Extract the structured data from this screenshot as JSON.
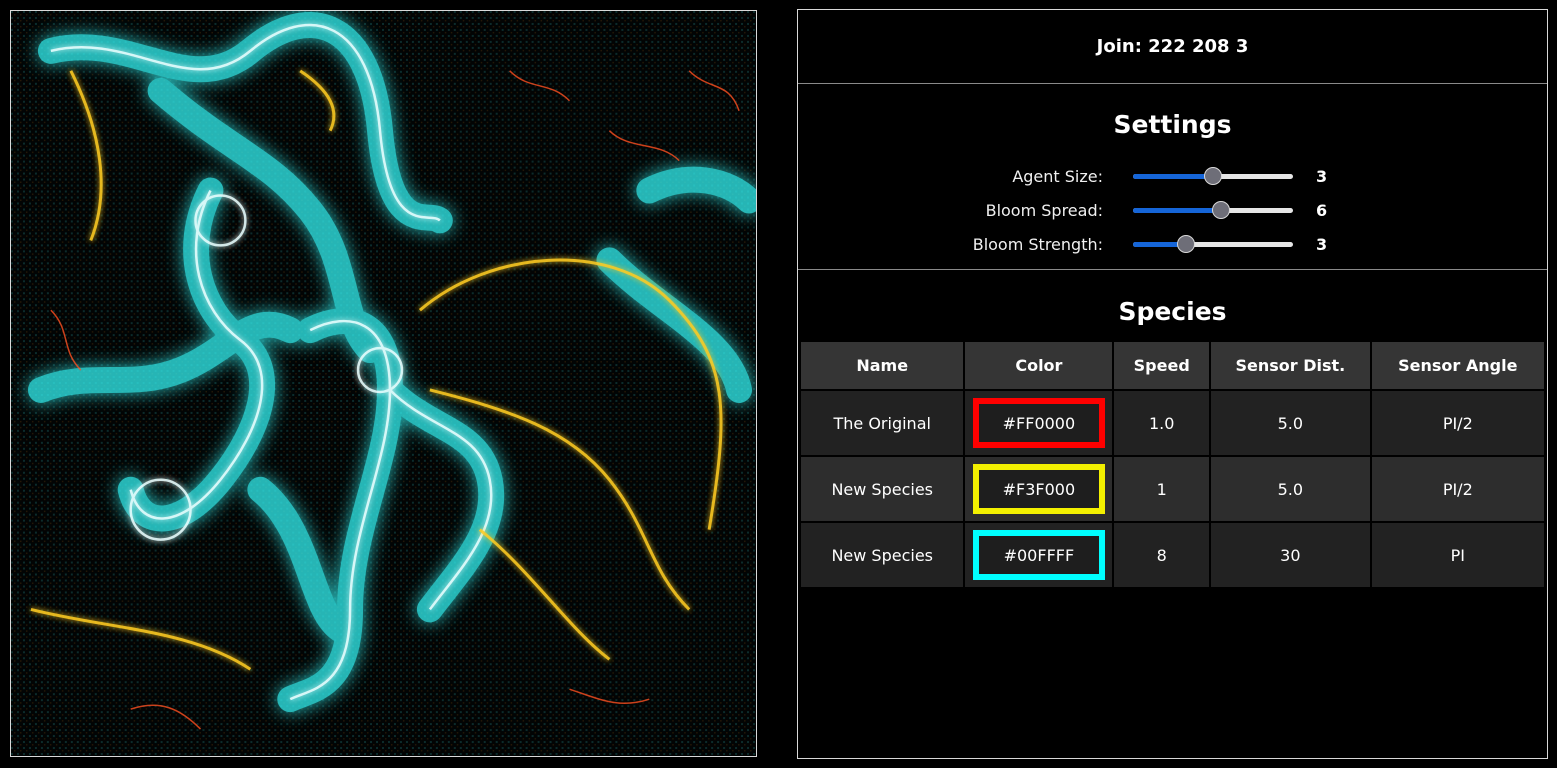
{
  "join": {
    "label": "Join: 222 208 3"
  },
  "settings": {
    "title": "Settings",
    "agent_size": {
      "label": "Agent Size:",
      "value": "3",
      "fraction": 0.5
    },
    "bloom_spread": {
      "label": "Bloom Spread:",
      "value": "6",
      "fraction": 0.55
    },
    "bloom_strength": {
      "label": "Bloom Strength:",
      "value": "3",
      "fraction": 0.33
    }
  },
  "species": {
    "title": "Species",
    "headers": [
      "Name",
      "Color",
      "Speed",
      "Sensor Dist.",
      "Sensor Angle"
    ],
    "rows": [
      {
        "name": "The Original",
        "color": "#FF0000",
        "border": "#ff0000",
        "speed": "1.0",
        "sensor_dist": "5.0",
        "sensor_angle": "PI/2"
      },
      {
        "name": "New Species",
        "color": "#F3F000",
        "border": "#f3f000",
        "speed": "1",
        "sensor_dist": "5.0",
        "sensor_angle": "PI/2"
      },
      {
        "name": "New Species",
        "color": "#00FFFF",
        "border": "#00ffff",
        "speed": "8",
        "sensor_dist": "30",
        "sensor_angle": "PI"
      }
    ]
  }
}
